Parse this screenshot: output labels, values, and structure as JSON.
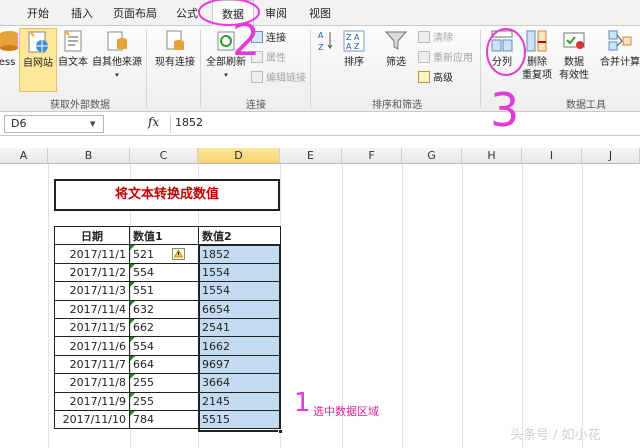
{
  "menu": {
    "tabs": [
      "开始",
      "插入",
      "页面布局",
      "公式",
      "数据",
      "审阅",
      "视图"
    ],
    "active": "数据"
  },
  "ribbon": {
    "external_data": {
      "label": "获取外部数据",
      "buttons": [
        "ess",
        "自网站",
        "自文本",
        "自其他来源",
        "现有连接"
      ]
    },
    "connections": {
      "label": "连接",
      "refresh_all": "全部刷新",
      "items": [
        "连接",
        "属性",
        "编辑链接"
      ]
    },
    "sort_filter": {
      "label": "排序和筛选",
      "sort": "排序",
      "filter": "筛选",
      "items": [
        "清除",
        "重新应用",
        "高级"
      ]
    },
    "data_tools": {
      "label": "数据工具",
      "text_to_columns": "分列",
      "remove_duplicates": [
        "删除",
        "重复项"
      ],
      "data_validation": [
        "数据",
        "有效性"
      ],
      "consolidate": "合并计算"
    }
  },
  "formula_bar": {
    "name_box": "D6",
    "fx": "fx",
    "value": "1852"
  },
  "columns": [
    "A",
    "B",
    "C",
    "D",
    "E",
    "F",
    "G",
    "H",
    "I",
    "J"
  ],
  "selected_column": "D",
  "sheet": {
    "title": "将文本转换成数值",
    "headers": [
      "日期",
      "数值1",
      "数值2"
    ],
    "rows": [
      [
        "2017/11/1",
        "521",
        "1852"
      ],
      [
        "2017/11/2",
        "554",
        "1554"
      ],
      [
        "2017/11/3",
        "551",
        "1554"
      ],
      [
        "2017/11/4",
        "632",
        "6654"
      ],
      [
        "2017/11/5",
        "662",
        "2541"
      ],
      [
        "2017/11/6",
        "554",
        "1662"
      ],
      [
        "2017/11/7",
        "664",
        "9697"
      ],
      [
        "2017/11/8",
        "255",
        "3664"
      ],
      [
        "2017/11/9",
        "255",
        "2145"
      ],
      [
        "2017/11/10",
        "784",
        "5515"
      ]
    ]
  },
  "annotations": {
    "step1": "1",
    "step2": "2",
    "step3": "3",
    "note": "选中数据区域"
  },
  "watermark": "头条号 / 如小花",
  "colors": {
    "title_text": "#c00000",
    "selection": "#c4dcf1",
    "annotation": "#e33bd7",
    "active_column_header": "#f6d36d"
  }
}
